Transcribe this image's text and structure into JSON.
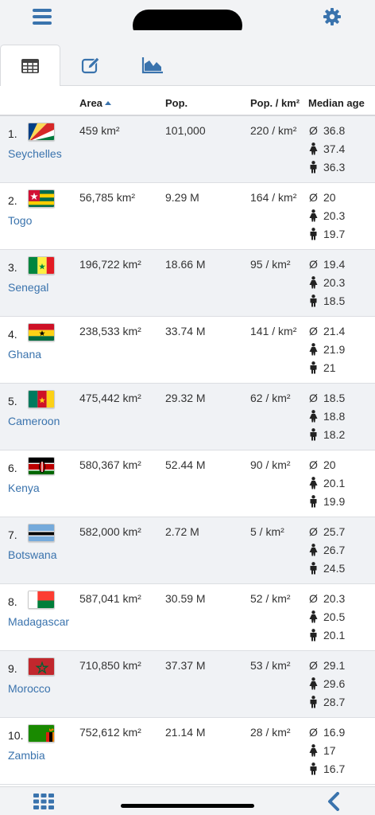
{
  "header": {
    "menu_icon": "hamburger-menu-icon",
    "settings_icon": "gear-icon"
  },
  "tabs": [
    {
      "icon": "table-icon",
      "active": true
    },
    {
      "icon": "edit-icon",
      "active": false
    },
    {
      "icon": "area-chart-icon",
      "active": false
    }
  ],
  "table": {
    "columns": {
      "area": "Area",
      "pop": "Pop.",
      "density": "Pop. / km²",
      "median_age": "Median age"
    },
    "sort": {
      "column": "area",
      "direction": "ascending"
    },
    "age_symbols": {
      "all": "Ø",
      "female": "female-icon",
      "male": "male-icon"
    },
    "rows": [
      {
        "rank": "1.",
        "country": "Seychelles",
        "flag": "seychelles-flag-icon",
        "area": "459 km²",
        "pop": "101,000",
        "density": "220 / km²",
        "age_all": "36.8",
        "age_f": "37.4",
        "age_m": "36.3"
      },
      {
        "rank": "2.",
        "country": "Togo",
        "flag": "togo-flag-icon",
        "area": "56,785 km²",
        "pop": "9.29 M",
        "density": "164 / km²",
        "age_all": "20",
        "age_f": "20.3",
        "age_m": "19.7"
      },
      {
        "rank": "3.",
        "country": "Senegal",
        "flag": "senegal-flag-icon",
        "area": "196,722 km²",
        "pop": "18.66 M",
        "density": "95 / km²",
        "age_all": "19.4",
        "age_f": "20.3",
        "age_m": "18.5"
      },
      {
        "rank": "4.",
        "country": "Ghana",
        "flag": "ghana-flag-icon",
        "area": "238,533 km²",
        "pop": "33.74 M",
        "density": "141 / km²",
        "age_all": "21.4",
        "age_f": "21.9",
        "age_m": "21"
      },
      {
        "rank": "5.",
        "country": "Cameroon",
        "flag": "cameroon-flag-icon",
        "area": "475,442 km²",
        "pop": "29.32 M",
        "density": "62 / km²",
        "age_all": "18.5",
        "age_f": "18.8",
        "age_m": "18.2"
      },
      {
        "rank": "6.",
        "country": "Kenya",
        "flag": "kenya-flag-icon",
        "area": "580,367 km²",
        "pop": "52.44 M",
        "density": "90 / km²",
        "age_all": "20",
        "age_f": "20.1",
        "age_m": "19.9"
      },
      {
        "rank": "7.",
        "country": "Botswana",
        "flag": "botswana-flag-icon",
        "area": "582,000 km²",
        "pop": "2.72 M",
        "density": "5 / km²",
        "age_all": "25.7",
        "age_f": "26.7",
        "age_m": "24.5"
      },
      {
        "rank": "8.",
        "country": "Madagascar",
        "flag": "madagascar-flag-icon",
        "area": "587,041 km²",
        "pop": "30.59 M",
        "density": "52 / km²",
        "age_all": "20.3",
        "age_f": "20.5",
        "age_m": "20.1"
      },
      {
        "rank": "9.",
        "country": "Morocco",
        "flag": "morocco-flag-icon",
        "area": "710,850 km²",
        "pop": "37.37 M",
        "density": "53 / km²",
        "age_all": "29.1",
        "age_f": "29.6",
        "age_m": "28.7"
      },
      {
        "rank": "10.",
        "country": "Zambia",
        "flag": "zambia-flag-icon",
        "area": "752,612 km²",
        "pop": "21.14 M",
        "density": "28 / km²",
        "age_all": "16.9",
        "age_f": "17",
        "age_m": "16.7"
      }
    ]
  },
  "footer": {
    "grid_icon": "grid-apps-icon",
    "back_icon": "chevron-left-icon"
  },
  "colors": {
    "accent": "#3a73ad",
    "bar_background": "#f2f3f5",
    "row_alt": "#f0f2f5"
  }
}
